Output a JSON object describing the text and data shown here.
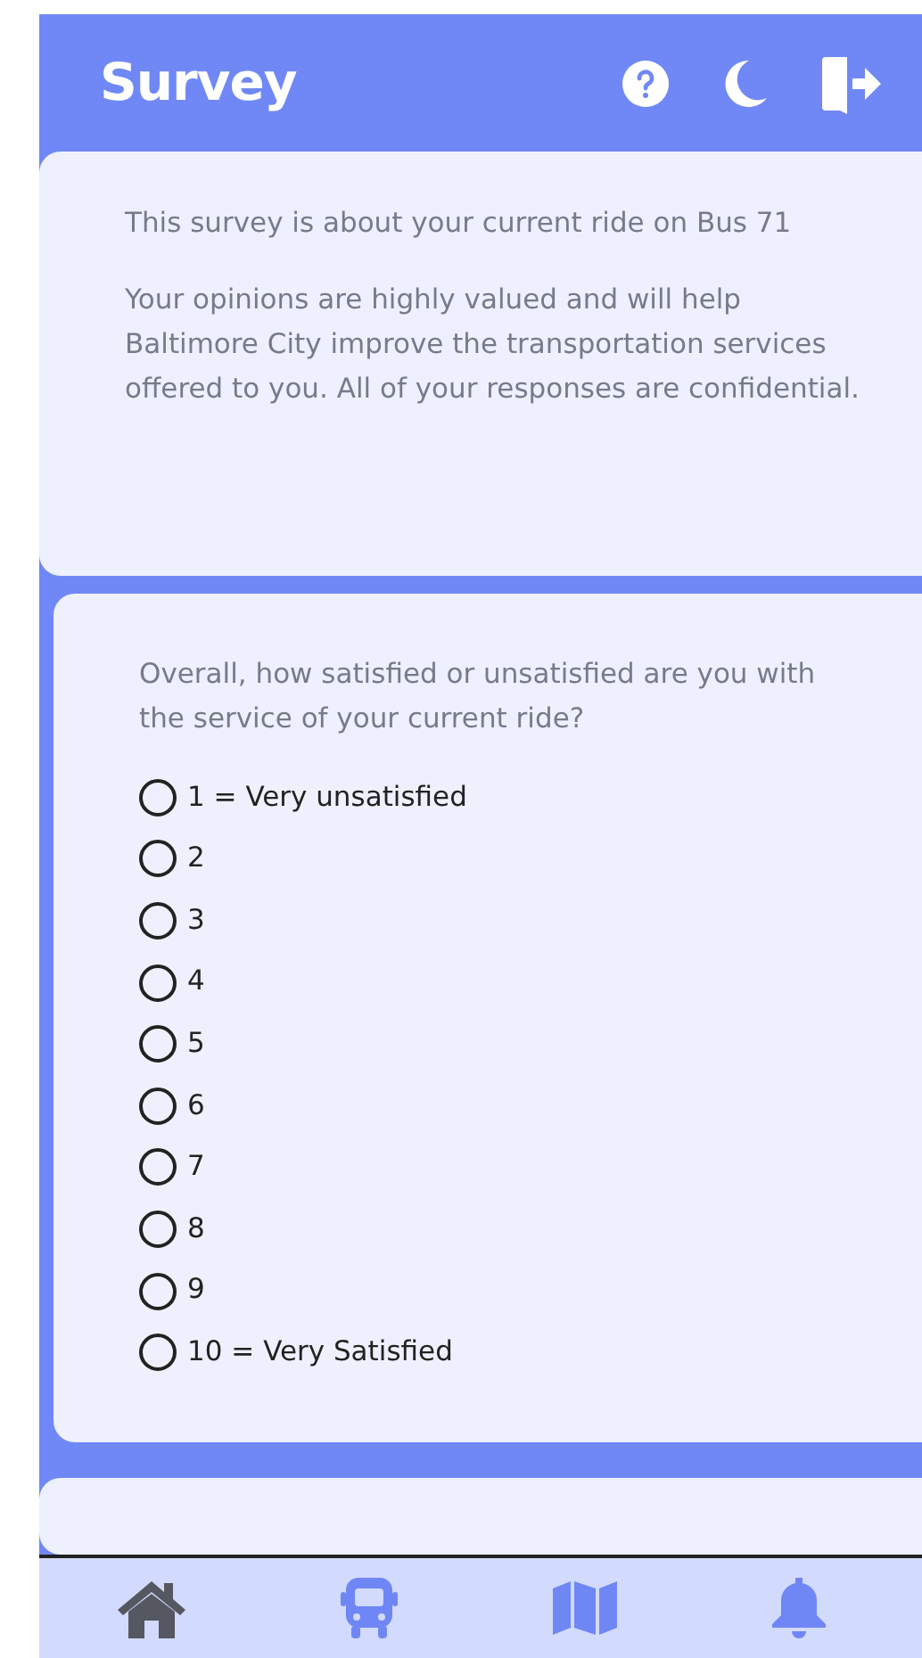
{
  "header": {
    "title": "Survey"
  },
  "intro": {
    "paragraphs": [
      "This survey is about your current ride on Bus 71",
      "Your opinions are highly valued and will help Baltimore City improve the transportation services offered to you. All of your responses are confidential."
    ]
  },
  "question": {
    "prompt": "Overall, how satisfied or unsatisfied are you with the service of your current ride?",
    "options": [
      {
        "label": "1 = Very unsatisfied",
        "selected": false
      },
      {
        "label": "2",
        "selected": false
      },
      {
        "label": "3",
        "selected": false
      },
      {
        "label": "4",
        "selected": false
      },
      {
        "label": "5",
        "selected": false
      },
      {
        "label": "6",
        "selected": false
      },
      {
        "label": "7",
        "selected": false
      },
      {
        "label": "8",
        "selected": false
      },
      {
        "label": "9",
        "selected": false
      },
      {
        "label": "10 = Very Satisfied",
        "selected": false
      }
    ]
  },
  "bottom_nav": [
    {
      "kind": "home",
      "selected": true
    },
    {
      "kind": "bus",
      "selected": false
    },
    {
      "kind": "map",
      "selected": false
    },
    {
      "kind": "bell",
      "selected": false
    }
  ]
}
